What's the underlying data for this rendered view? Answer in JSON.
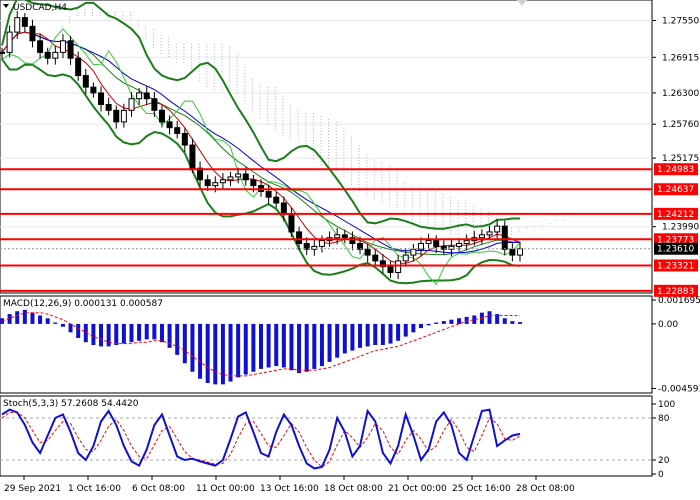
{
  "symbol_title": "USDCAD,H4",
  "macd_label": "MACD(12,26,9) 0.000131 0.000587",
  "stoch_label": "Stoch(5,3,3) 57.2608 54.4420",
  "colors": {
    "level_line": "#ff0000",
    "level_box": "#ff0000",
    "current_box": "#000000",
    "bollinger": "#1a7f1a",
    "ma_blue": "#0000cc",
    "ma_red": "#cc0000",
    "lime": "#33cc33",
    "ichimoku_a": "#f4a070",
    "ichimoku_b": "#b090d0",
    "histogram": "#1010d0",
    "signal": "#ff0000",
    "stoch_main": "#1010d0"
  },
  "chart_data": [
    {
      "type": "line",
      "title": "USDCAD,H4",
      "price_axis_ticks": [
        "1.27550",
        "1.26915",
        "1.26300",
        "1.25760",
        "1.25175",
        "1.23990"
      ],
      "price_levels": [
        "1.24983",
        "1.24637",
        "1.24212",
        "1.23773",
        "1.23321",
        "1.22883"
      ],
      "current_price": "1.23610",
      "ylim": [
        1.2288,
        1.2787
      ],
      "time_labels": [
        "29 Sep 2021",
        "1 Oct 16:00",
        "6 Oct 08:00",
        "11 Oct 00:00",
        "13 Oct 16:00",
        "18 Oct 08:00",
        "21 Oct 00:00",
        "25 Oct 16:00",
        "28 Oct 08:00"
      ],
      "series": [
        {
          "name": "USDCAD",
          "values": [
            1.27,
            1.2735,
            1.276,
            1.2745,
            1.272,
            1.27,
            1.269,
            1.27,
            1.272,
            1.269,
            1.266,
            1.264,
            1.263,
            1.261,
            1.26,
            1.258,
            1.26,
            1.262,
            1.263,
            1.262,
            1.26,
            1.258,
            1.257,
            1.256,
            1.254,
            1.25,
            1.248,
            1.247,
            1.2475,
            1.248,
            1.2485,
            1.249,
            1.248,
            1.247,
            1.246,
            1.245,
            1.244,
            1.242,
            1.239,
            1.237,
            1.236,
            1.2365,
            1.2375,
            1.238,
            1.2385,
            1.238,
            1.237,
            1.236,
            1.235,
            1.234,
            1.233,
            1.232,
            1.234,
            1.235,
            1.236,
            1.237,
            1.2375,
            1.2365,
            1.236,
            1.2365,
            1.237,
            1.2375,
            1.238,
            1.2385,
            1.239,
            1.24,
            1.236,
            1.235,
            1.2361
          ]
        }
      ]
    },
    {
      "type": "bar",
      "title": "MACD(12,26,9) 0.000131 0.000587",
      "axis_ticks": [
        "0.001695",
        "0.00",
        "-0.004591"
      ],
      "ylim": [
        -0.0047,
        0.0017
      ],
      "series": [
        {
          "name": "MACD",
          "values": [
            0.0004,
            0.0007,
            0.0009,
            0.001,
            0.0008,
            0.0006,
            0.0004,
            0.0001,
            -0.0002,
            -0.0006,
            -0.001,
            -0.0013,
            -0.0015,
            -0.0016,
            -0.0016,
            -0.0015,
            -0.0014,
            -0.0013,
            -0.0012,
            -0.0011,
            -0.0011,
            -0.0013,
            -0.0017,
            -0.0022,
            -0.0028,
            -0.0034,
            -0.0039,
            -0.0042,
            -0.0043,
            -0.0043,
            -0.0041,
            -0.0038,
            -0.0036,
            -0.0034,
            -0.0032,
            -0.0031,
            -0.003,
            -0.0031,
            -0.0033,
            -0.0035,
            -0.0034,
            -0.0032,
            -0.003,
            -0.0027,
            -0.0024,
            -0.0021,
            -0.0019,
            -0.0017,
            -0.0016,
            -0.0015,
            -0.0015,
            -0.0014,
            -0.0012,
            -0.0009,
            -0.0006,
            -0.0003,
            -0.0001,
            0.0001,
            0.0002,
            0.0003,
            0.0004,
            0.0005,
            0.0006,
            0.0008,
            0.0009,
            0.0007,
            0.0004,
            0.0002,
            0.00013
          ]
        },
        {
          "name": "Signal",
          "values": [
            0.0002,
            0.0004,
            0.0006,
            0.0008,
            0.0008,
            0.0008,
            0.0007,
            0.0005,
            0.0003,
            0.0,
            -0.0003,
            -0.0006,
            -0.0009,
            -0.0011,
            -0.0013,
            -0.0014,
            -0.0014,
            -0.0014,
            -0.0013,
            -0.0013,
            -0.0012,
            -0.0012,
            -0.0014,
            -0.0016,
            -0.0019,
            -0.0023,
            -0.0027,
            -0.0031,
            -0.0034,
            -0.0036,
            -0.0037,
            -0.0037,
            -0.0037,
            -0.0036,
            -0.0035,
            -0.0034,
            -0.0033,
            -0.0032,
            -0.0032,
            -0.0033,
            -0.0033,
            -0.0033,
            -0.0032,
            -0.0031,
            -0.0029,
            -0.0027,
            -0.0025,
            -0.0023,
            -0.0021,
            -0.0019,
            -0.0018,
            -0.0017,
            -0.0016,
            -0.0014,
            -0.0012,
            -0.001,
            -0.0008,
            -0.0006,
            -0.0004,
            -0.0002,
            0.0,
            0.0002,
            0.0003,
            0.0004,
            0.0006,
            0.0006,
            0.0006,
            0.0006,
            0.000587
          ]
        }
      ]
    },
    {
      "type": "line",
      "title": "Stoch(5,3,3) 57.2608 54.4420",
      "axis_ticks": [
        "100",
        "80",
        "20",
        "0"
      ],
      "ylim": [
        0,
        100
      ],
      "series": [
        {
          "name": "Main",
          "values": [
            85,
            92,
            88,
            70,
            45,
            30,
            55,
            80,
            85,
            60,
            30,
            20,
            40,
            75,
            90,
            70,
            40,
            18,
            12,
            35,
            70,
            85,
            55,
            25,
            20,
            22,
            18,
            15,
            12,
            20,
            50,
            82,
            88,
            60,
            30,
            25,
            60,
            85,
            70,
            40,
            15,
            8,
            10,
            35,
            80,
            60,
            25,
            40,
            90,
            75,
            30,
            15,
            40,
            85,
            55,
            20,
            35,
            75,
            88,
            70,
            30,
            20,
            55,
            90,
            92,
            40,
            48,
            55,
            57.26
          ]
        },
        {
          "name": "Signal",
          "values": [
            80,
            88,
            88,
            80,
            62,
            45,
            48,
            62,
            75,
            72,
            52,
            35,
            32,
            48,
            68,
            78,
            62,
            40,
            25,
            22,
            42,
            62,
            68,
            50,
            32,
            22,
            20,
            17,
            14,
            15,
            28,
            52,
            72,
            75,
            58,
            40,
            38,
            55,
            72,
            60,
            38,
            20,
            10,
            18,
            42,
            62,
            52,
            38,
            52,
            72,
            62,
            38,
            28,
            48,
            62,
            50,
            32,
            40,
            62,
            78,
            62,
            38,
            32,
            55,
            80,
            72,
            50,
            48,
            54.44
          ]
        }
      ]
    }
  ]
}
